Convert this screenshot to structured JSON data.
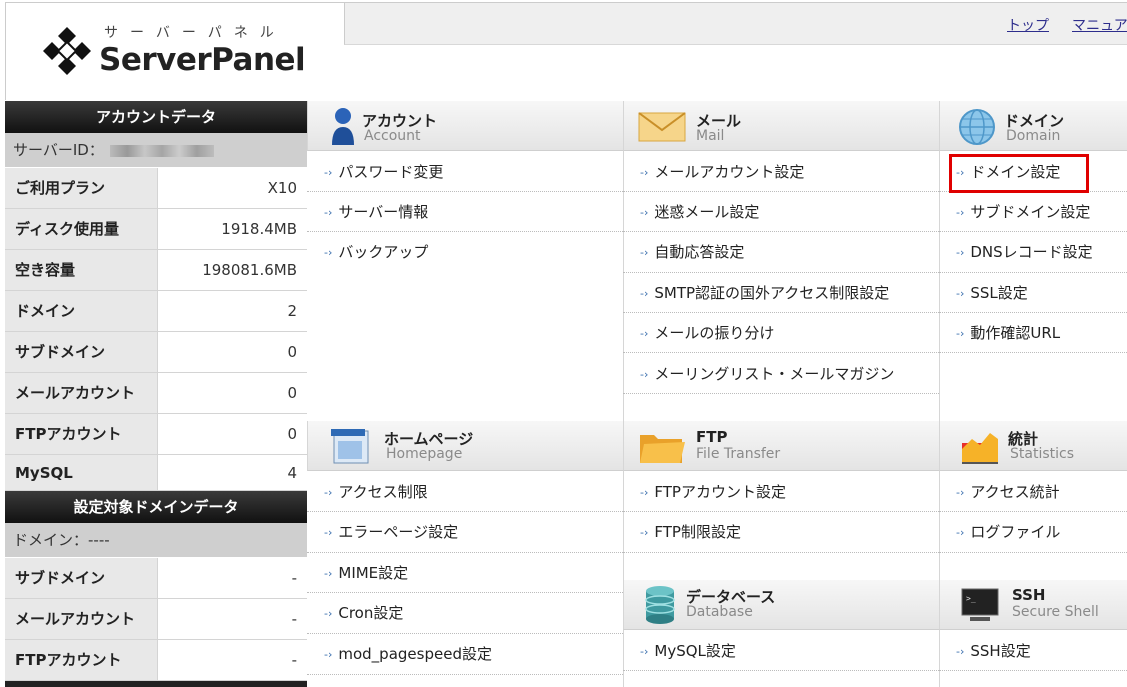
{
  "header": {
    "logo_ruby": "サーバーパネル",
    "logo_text": "ServerPanel",
    "links": [
      "トップ",
      "マニュア"
    ]
  },
  "sidebar": {
    "account_title": "アカウントデータ",
    "server_id_label": "サーバーID：",
    "account_rows": [
      {
        "key": "ご利用プラン",
        "value": "X10"
      },
      {
        "key": "ディスク使用量",
        "value": "1918.4MB"
      },
      {
        "key": "空き容量",
        "value": "198081.6MB"
      },
      {
        "key": "ドメイン",
        "value": "2"
      },
      {
        "key": "サブドメイン",
        "value": "0"
      },
      {
        "key": "メールアカウント",
        "value": "0"
      },
      {
        "key": "FTPアカウント",
        "value": "0"
      },
      {
        "key": "MySQL",
        "value": "4"
      }
    ],
    "domain_title": "設定対象ドメインデータ",
    "domain_label": "ドメイン：----",
    "domain_rows": [
      {
        "key": "サブドメイン",
        "value": "-"
      },
      {
        "key": "メールアカウント",
        "value": "-"
      },
      {
        "key": "FTPアカウント",
        "value": "-"
      }
    ]
  },
  "sections": {
    "account": {
      "title": "アカウント",
      "subtitle": "Account",
      "icon": "account-icon",
      "items": [
        "パスワード変更",
        "サーバー情報",
        "バックアップ"
      ]
    },
    "mail": {
      "title": "メール",
      "subtitle": "Mail",
      "icon": "mail-icon",
      "items": [
        "メールアカウント設定",
        "迷惑メール設定",
        "自動応答設定",
        "SMTP認証の国外アクセス制限設定",
        "メールの振り分け",
        "メーリングリスト・メールマガジン"
      ]
    },
    "domain": {
      "title": "ドメイン",
      "subtitle": "Domain",
      "icon": "globe-icon",
      "items": [
        "ドメイン設定",
        "サブドメイン設定",
        "DNSレコード設定",
        "SSL設定",
        "動作確認URL"
      ]
    },
    "homepage": {
      "title": "ホームページ",
      "subtitle": "Homepage",
      "icon": "homepage-icon",
      "items": [
        "アクセス制限",
        "エラーページ設定",
        "MIME設定",
        "Cron設定",
        "mod_pagespeed設定"
      ]
    },
    "ftp": {
      "title": "FTP",
      "subtitle": "File Transfer",
      "icon": "folder-icon",
      "items": [
        "FTPアカウント設定",
        "FTP制限設定"
      ]
    },
    "stats": {
      "title": "統計",
      "subtitle": "Statistics",
      "icon": "chart-icon",
      "items": [
        "アクセス統計",
        "ログファイル"
      ]
    },
    "database": {
      "title": "データベース",
      "subtitle": "Database",
      "icon": "database-icon",
      "items": [
        "MySQL設定"
      ]
    },
    "ssh": {
      "title": "SSH",
      "subtitle": "Secure Shell",
      "icon": "terminal-icon",
      "items": [
        "SSH設定"
      ]
    }
  },
  "highlight_color": "#e00000",
  "accent_color": "#3a6fae"
}
